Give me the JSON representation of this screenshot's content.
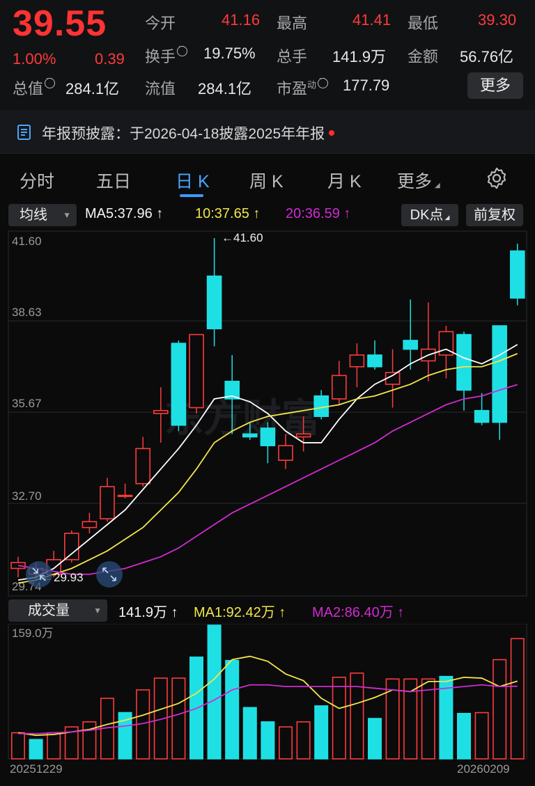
{
  "quote": {
    "price": "39.55",
    "change_pct": "1.00%",
    "change": "0.39",
    "open_label": "今开",
    "open": "41.16",
    "high_label": "最高",
    "high": "41.41",
    "low_label": "最低",
    "low": "39.30",
    "turnover_label": "换手",
    "turnover": "19.75%",
    "volume_label": "总手",
    "volume": "141.9万",
    "amount_label": "金额",
    "amount": "56.76亿",
    "mcap_label": "总值",
    "mcap": "284.1亿",
    "float_label": "流值",
    "float": "284.1亿",
    "pe_label": "市盈",
    "pe_sup": "动",
    "pe": "177.79",
    "more_button": "更多"
  },
  "notice": {
    "text": "年报预披露：于2026-04-18披露2025年年报"
  },
  "tabs": [
    {
      "label": "分时"
    },
    {
      "label": "五日"
    },
    {
      "label": "日 K"
    },
    {
      "label": "周 K"
    },
    {
      "label": "月 K"
    },
    {
      "label": "更多"
    }
  ],
  "ma_bar": {
    "selector": "均线",
    "ma5": "MA5:37.96 ↑",
    "ma10": "10:37.65 ↑",
    "ma20": "20:36.59 ↑",
    "dk_button": "DK点",
    "adjust_button": "前复权"
  },
  "kline": {
    "y_ticks": [
      "41.60",
      "38.63",
      "35.67",
      "32.70",
      "29.74"
    ],
    "max_label": "←41.60",
    "min_label": "←29.93",
    "watermark": "东方财富"
  },
  "volume_bar": {
    "selector": "成交量",
    "vol": "141.9万 ↑",
    "ma1": "MA1:92.42万 ↑",
    "ma2": "MA2:86.40万 ↑",
    "y_max": "159.0万"
  },
  "dates": {
    "start": "20251229",
    "end": "20260209"
  },
  "colors": {
    "up": "#ff3b3b",
    "down": "#1ee0e4",
    "ma5": "#ffffff",
    "ma10": "#f2e64a",
    "ma20": "#d12bd1",
    "accent": "#3b9bff"
  },
  "chart_data": {
    "type": "candlestick",
    "ylim": [
      29.74,
      41.6
    ],
    "candles": [
      {
        "o": 30.3,
        "c": 30.5,
        "h": 30.7,
        "l": 30.0
      },
      {
        "o": 30.1,
        "c": 30.3,
        "h": 30.5,
        "l": 29.93
      },
      {
        "o": 30.1,
        "c": 30.6,
        "h": 30.9,
        "l": 30.0
      },
      {
        "o": 30.6,
        "c": 31.5,
        "h": 31.6,
        "l": 30.5
      },
      {
        "o": 31.7,
        "c": 31.9,
        "h": 32.2,
        "l": 31.5
      },
      {
        "o": 32.0,
        "c": 33.1,
        "h": 33.4,
        "l": 31.9
      },
      {
        "o": 32.8,
        "c": 32.8,
        "h": 33.2,
        "l": 32.7
      },
      {
        "o": 33.2,
        "c": 34.4,
        "h": 34.8,
        "l": 33.1
      },
      {
        "o": 35.6,
        "c": 35.7,
        "h": 36.5,
        "l": 34.6
      },
      {
        "o": 38.0,
        "c": 35.2,
        "h": 38.1,
        "l": 35.0
      },
      {
        "o": 35.8,
        "c": 38.3,
        "h": 38.3,
        "l": 35.6
      },
      {
        "o": 40.3,
        "c": 38.5,
        "h": 41.6,
        "l": 37.9
      },
      {
        "o": 36.7,
        "c": 36.1,
        "h": 37.6,
        "l": 34.9
      },
      {
        "o": 34.9,
        "c": 34.8,
        "h": 35.3,
        "l": 34.7
      },
      {
        "o": 35.1,
        "c": 34.5,
        "h": 35.3,
        "l": 33.9
      },
      {
        "o": 34.0,
        "c": 34.5,
        "h": 34.9,
        "l": 33.7
      },
      {
        "o": 34.8,
        "c": 34.9,
        "h": 35.5,
        "l": 34.3
      },
      {
        "o": 36.2,
        "c": 35.5,
        "h": 36.4,
        "l": 35.4
      },
      {
        "o": 36.1,
        "c": 36.9,
        "h": 37.4,
        "l": 35.9
      },
      {
        "o": 37.2,
        "c": 37.6,
        "h": 38.0,
        "l": 36.5
      },
      {
        "o": 37.6,
        "c": 37.2,
        "h": 38.1,
        "l": 37.1
      },
      {
        "o": 36.6,
        "c": 37.0,
        "h": 37.8,
        "l": 35.8
      },
      {
        "o": 38.1,
        "c": 37.8,
        "h": 39.5,
        "l": 37.1
      },
      {
        "o": 37.4,
        "c": 37.8,
        "h": 39.4,
        "l": 36.7
      },
      {
        "o": 37.6,
        "c": 38.4,
        "h": 38.6,
        "l": 36.8
      },
      {
        "o": 38.3,
        "c": 36.4,
        "h": 38.4,
        "l": 35.7
      },
      {
        "o": 35.7,
        "c": 35.3,
        "h": 36.3,
        "l": 35.2
      },
      {
        "o": 38.6,
        "c": 35.3,
        "h": 38.6,
        "l": 34.7
      },
      {
        "o": 41.16,
        "c": 39.55,
        "h": 41.41,
        "l": 39.3
      }
    ],
    "ma5": [
      29.9,
      30.0,
      30.3,
      30.8,
      31.3,
      31.8,
      32.3,
      33.0,
      33.7,
      34.4,
      35.2,
      36.1,
      36.2,
      36.0,
      35.6,
      35.0,
      34.6,
      34.6,
      35.4,
      36.1,
      36.6,
      36.9,
      37.3,
      37.6,
      37.8,
      37.5,
      37.3,
      37.6,
      37.96
    ],
    "ma10": [
      29.8,
      29.9,
      30.1,
      30.3,
      30.6,
      30.9,
      31.3,
      31.7,
      32.3,
      32.9,
      33.7,
      34.6,
      35.0,
      35.3,
      35.5,
      35.6,
      35.7,
      35.8,
      35.9,
      36.1,
      36.2,
      36.4,
      36.6,
      36.9,
      37.1,
      37.2,
      37.2,
      37.4,
      37.65
    ],
    "ma20": [
      30.4,
      30.3,
      30.2,
      30.1,
      30.1,
      30.2,
      30.3,
      30.5,
      30.7,
      31.0,
      31.4,
      31.8,
      32.2,
      32.5,
      32.8,
      33.1,
      33.4,
      33.7,
      34.0,
      34.3,
      34.6,
      35.0,
      35.3,
      35.6,
      35.9,
      36.1,
      36.2,
      36.4,
      36.59
    ],
    "volume": {
      "ylim": [
        0,
        159.0
      ],
      "up": [
        true,
        false,
        true,
        true,
        true,
        true,
        false,
        true,
        true,
        true,
        false,
        false,
        false,
        false,
        false,
        true,
        true,
        false,
        true,
        true,
        false,
        true,
        true,
        true,
        false,
        false,
        true,
        true,
        true
      ],
      "values": [
        31,
        23,
        31,
        38,
        44,
        72,
        55,
        82,
        96,
        96,
        121,
        159,
        117,
        61,
        44,
        38,
        44,
        63,
        97,
        102,
        48,
        95,
        95,
        95,
        98,
        54,
        55,
        118,
        143
      ],
      "ma1": [
        31,
        28,
        29,
        32,
        35,
        41,
        46,
        52,
        59,
        66,
        78,
        95,
        118,
        122,
        116,
        101,
        93,
        72,
        60,
        66,
        73,
        82,
        80,
        92,
        92,
        97,
        96,
        86,
        92.42
      ],
      "ma2": [
        30,
        30,
        31,
        32,
        34,
        37,
        39,
        42,
        47,
        53,
        60,
        70,
        82,
        88,
        88,
        86,
        86,
        86,
        86,
        86,
        84,
        82,
        80,
        82,
        84,
        86,
        88,
        86,
        86.4
      ]
    }
  }
}
